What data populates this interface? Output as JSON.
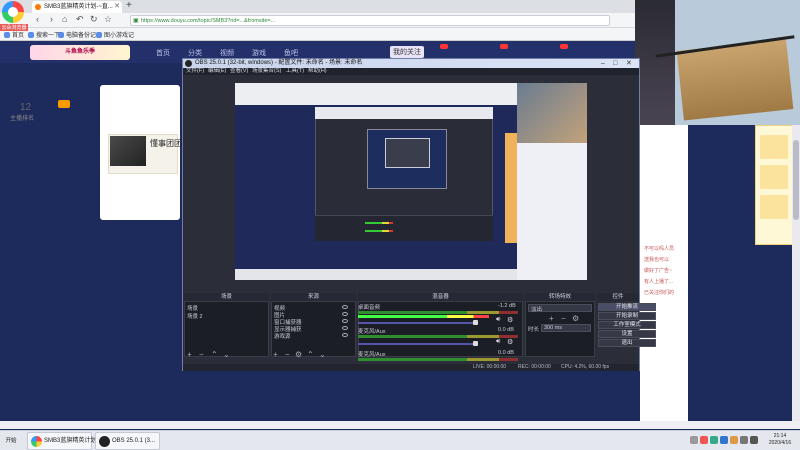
{
  "browser": {
    "app_name": "云朵浏览器",
    "tab_title": "SMB3蓝旗精英计划-~直...",
    "url": "https://www.douyu.com/topic/SMB3?rid=...&fromsite=...",
    "bookmarks": [
      "首页",
      "搜索一下",
      "电脑备份记",
      "图小游戏记"
    ]
  },
  "site": {
    "logo_text": "斗鱼鱼乐季",
    "nav": [
      "首页",
      "分类",
      "视频",
      "游戏",
      "鱼吧",
      "我的关注"
    ],
    "rank_value": "12",
    "rank_label": "主播排名",
    "video_title": "懂事团团",
    "right_list": [
      "不可以吗人员",
      "送我也可以",
      "做好了广告~",
      "有人上播了...",
      "已关注你们的"
    ]
  },
  "obs": {
    "title": "OBS 25.0.1 (32-bit, windows) - 配置文件: 未命名 - 场景: 未命名",
    "menu": [
      "文件(F)",
      "编辑(E)",
      "查看(V)",
      "场景集合(S)",
      "工具(T)",
      "帮助(H)"
    ],
    "docks": {
      "scenes": "场景",
      "sources": "来源",
      "mixer": "混音器",
      "transitions": "转场特效",
      "controls": "控件"
    },
    "scenes": [
      "场景",
      "场景 2"
    ],
    "sources": [
      "视频",
      "图片",
      "窗口捕获器",
      "显示器捕获",
      "游戏源"
    ],
    "mixer": [
      {
        "name": "桌面音频",
        "db": "-1.2 dB"
      },
      {
        "name": "麦克风/Aux",
        "db": "0.0 dB"
      },
      {
        "name": "麦克风/Aux",
        "db": "0.0 dB"
      }
    ],
    "transition": {
      "type": "淡出",
      "duration_label": "时长",
      "duration": "300 ms"
    },
    "controls": [
      "开始推流",
      "开始录制",
      "工作室模式",
      "设置",
      "退出"
    ],
    "status": {
      "live": "LIVE: 00:00:00",
      "rec": "REC: 00:00:00",
      "cpu": "CPU: 4.2%, 60.00 fps"
    }
  },
  "taskbar": {
    "start_label": "开始",
    "items": [
      "SMB3蓝旗精英计划",
      "OBS 25.0.1 (3..."
    ],
    "time": "21:14",
    "date": "2020/4/16"
  }
}
